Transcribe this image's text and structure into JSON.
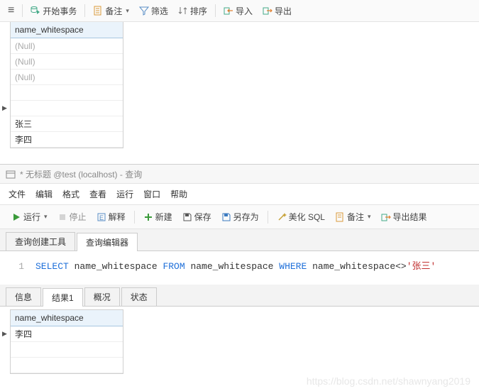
{
  "toolbar": {
    "hamburger": "≡",
    "begin_tx": "开始事务",
    "memo": "备注",
    "filter": "筛选",
    "sort": "排序",
    "import": "导入",
    "export": "导出"
  },
  "grid": {
    "column": "name_whitespace",
    "rows": [
      {
        "value": "(Null)",
        "null": true
      },
      {
        "value": "(Null)",
        "null": true
      },
      {
        "value": "(Null)",
        "null": true
      },
      {
        "value": "",
        "cursor": false
      },
      {
        "value": "",
        "cursor": true
      },
      {
        "value": "张三"
      },
      {
        "value": "李四"
      }
    ]
  },
  "query": {
    "title": "* 无标题 @test (localhost) - 查询",
    "menu": [
      "文件",
      "编辑",
      "格式",
      "查看",
      "运行",
      "窗口",
      "帮助"
    ],
    "tb": {
      "run": "运行",
      "stop": "停止",
      "explain": "解释",
      "new": "新建",
      "save": "保存",
      "save_as": "另存为",
      "beautify": "美化 SQL",
      "memo": "备注",
      "export_result": "导出结果"
    },
    "edittabs": {
      "builder": "查询创建工具",
      "editor": "查询编辑器"
    },
    "sql": {
      "line": "1",
      "tokens": [
        "SELECT",
        " name_whitespace ",
        "FROM",
        " name_whitespace ",
        "WHERE",
        " name_whitespace<>",
        "'张三'"
      ]
    },
    "resulttabs": [
      "信息",
      "结果1",
      "概况",
      "状态"
    ],
    "result": {
      "column": "name_whitespace",
      "rows": [
        {
          "value": "李四",
          "cursor": true
        },
        {
          "value": ""
        },
        {
          "value": ""
        }
      ]
    }
  },
  "watermark": "https://blog.csdn.net/shawnyang2019"
}
